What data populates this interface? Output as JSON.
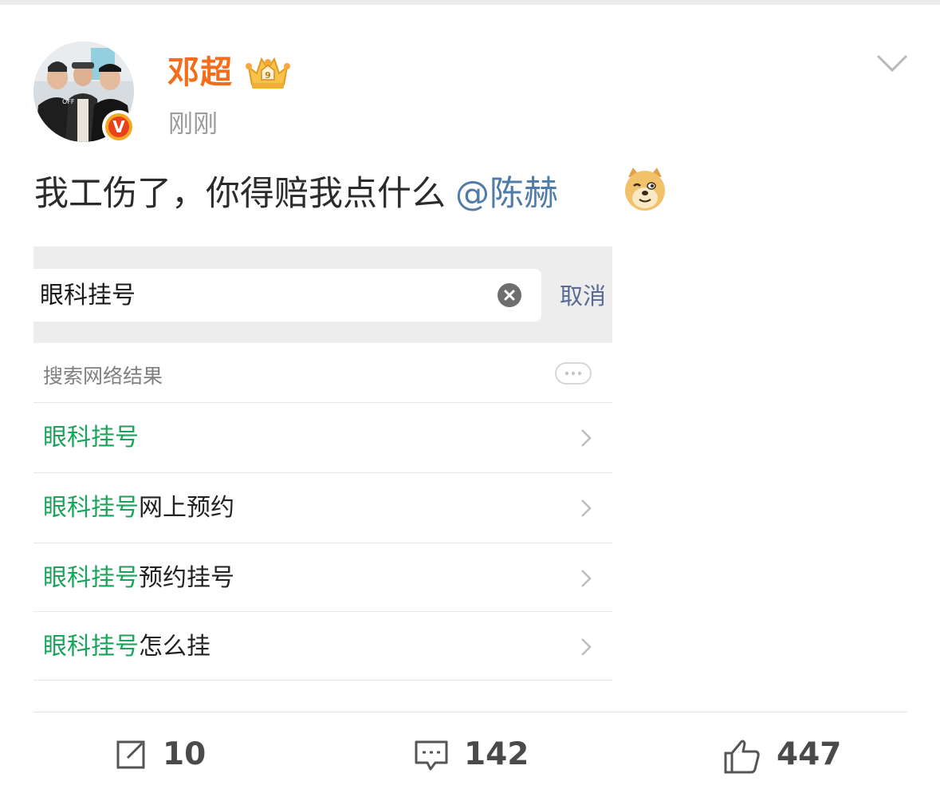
{
  "post": {
    "user": {
      "name": "邓超",
      "avatar_icon": "profile-photo",
      "verified_icon": "verified-v-badge",
      "verified_letter": "V",
      "vip_icon": "crown-vip-icon",
      "brand_color": "#f56c1b"
    },
    "time": "刚刚",
    "menu_icon": "chevron-down-icon",
    "text": "我工伤了，你得赔我点什么",
    "mention": "@陈赫",
    "emoji_icon": "doge-emoji"
  },
  "screenshot": {
    "search": {
      "query": "眼科挂号",
      "clear_icon": "clear-x-icon",
      "cancel_label": "取消"
    },
    "section_header": "搜索网络结果",
    "more_icon": "more-dots-icon",
    "results": [
      {
        "highlight": "眼科挂号",
        "rest": ""
      },
      {
        "highlight": "眼科挂号",
        "rest": "网上预约"
      },
      {
        "highlight": "眼科挂号",
        "rest": "预约挂号"
      },
      {
        "highlight": "眼科挂号",
        "rest": "怎么挂"
      }
    ],
    "highlight_color": "#1aa35a",
    "cancel_color": "#576b95"
  },
  "actions": {
    "repost_count": "10",
    "comment_count": "142",
    "like_count": "447"
  }
}
